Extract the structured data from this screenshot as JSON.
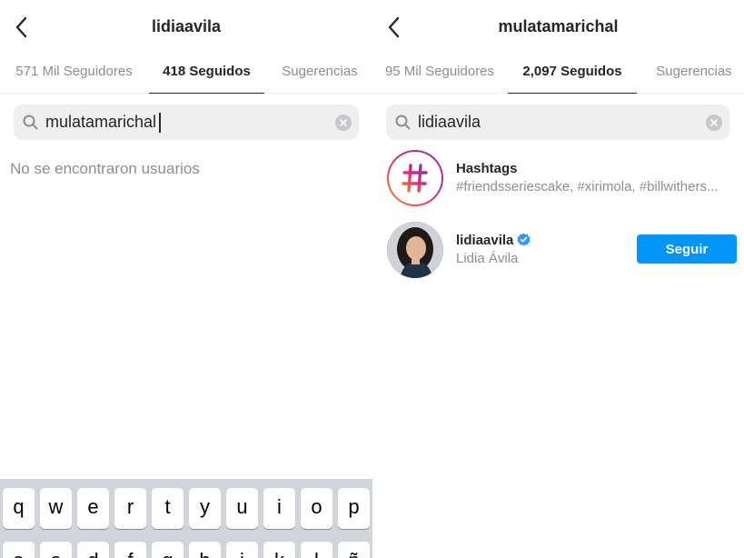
{
  "left": {
    "header": {
      "title": "lidiaavila"
    },
    "tabs": [
      {
        "label": "571 Mil Seguidores",
        "active": false
      },
      {
        "label": "418 Seguidos",
        "active": true
      },
      {
        "label": "Sugerencias",
        "active": false
      }
    ],
    "search": {
      "value": "mulatamarichal",
      "icon": "search-icon"
    },
    "empty_message": "No se encontraron usuarios",
    "keyboard": {
      "row1": [
        "q",
        "w",
        "e",
        "r",
        "t",
        "y",
        "u",
        "i",
        "o",
        "p"
      ],
      "row2": [
        "a",
        "s",
        "d",
        "f",
        "g",
        "h",
        "j",
        "k",
        "l",
        "ñ"
      ]
    }
  },
  "right": {
    "header": {
      "title": "mulatamarichal"
    },
    "tabs": [
      {
        "label": "95 Mil Seguidores",
        "active": false
      },
      {
        "label": "2,097 Seguidos",
        "active": true
      },
      {
        "label": "Sugerencias",
        "active": false
      }
    ],
    "search": {
      "value": "lidiaavila",
      "icon": "search-icon"
    },
    "results": {
      "hashtags": {
        "title": "Hashtags",
        "subtitle": "#friendsseriescake, #xirimola, #billwithers..."
      },
      "user": {
        "username": "lidiaavila",
        "full_name": "Lidia Ávila",
        "verified": true,
        "button_label": "Seguir"
      }
    }
  },
  "colors": {
    "accent": "#0095f6",
    "text": "#262626",
    "muted": "#8e8e8e",
    "search_bg": "#efefef"
  }
}
